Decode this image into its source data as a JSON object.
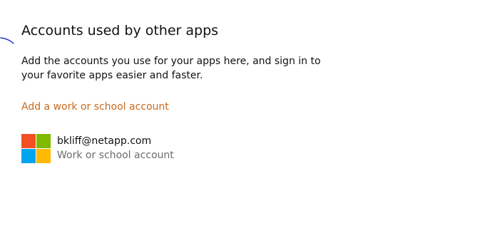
{
  "section": {
    "title": "Accounts used by other apps",
    "description": "Add the accounts you use for your apps here, and sign in to your favorite apps easier and faster."
  },
  "actions": {
    "add_account_label": "Add a work or school account"
  },
  "account": {
    "email": "bkliff@netapp.com",
    "type": "Work or school account",
    "logo_icon": "microsoft-logo-icon"
  },
  "colors": {
    "link": "#c76a1e",
    "logo_red": "#f25022",
    "logo_green": "#7fba00",
    "logo_blue": "#00a4ef",
    "logo_yellow": "#ffb900",
    "pen_mark": "#1a2fd0"
  }
}
